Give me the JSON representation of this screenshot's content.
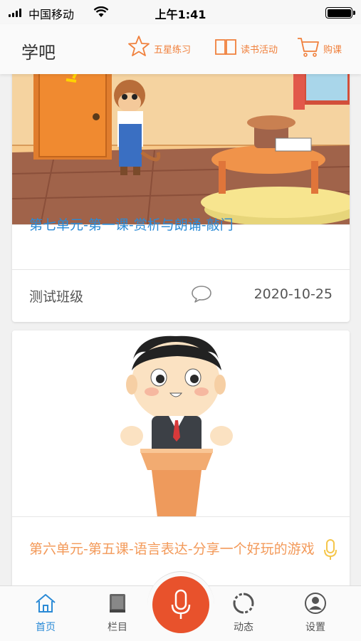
{
  "status_bar": {
    "carrier": "中国移动",
    "time": "上午1:41"
  },
  "header": {
    "title": "学吧",
    "actions": [
      {
        "label": "五星练习",
        "icon": "star-icon"
      },
      {
        "label": "读书活动",
        "icon": "book-icon"
      },
      {
        "label": "购课",
        "icon": "cart-icon"
      }
    ]
  },
  "cards": [
    {
      "image": "cartoon-monkey-at-door-illustration",
      "title": "第七单元-第一课-赏析与朗诵-敲门",
      "class_name": "测试班级",
      "comment_icon": "comment-icon",
      "date": "2020-10-25"
    },
    {
      "image": "cartoon-speaker-at-podium-illustration",
      "title": "第六单元-第五课-语言表达-分享一个好玩的游戏",
      "title_icon": "microphone-icon"
    }
  ],
  "tab_bar": {
    "items": [
      {
        "label": "首页",
        "icon": "home-icon",
        "active": true
      },
      {
        "label": "栏目",
        "icon": "book-stack-icon",
        "active": false
      },
      {
        "label": "动态",
        "icon": "refresh-circle-icon",
        "active": false
      },
      {
        "label": "设置",
        "icon": "user-settings-icon",
        "active": false
      }
    ],
    "record_icon": "microphone-icon"
  },
  "colors": {
    "accent_blue": "#2a8ad6",
    "accent_orange": "#f0803c",
    "record_red": "#e8522c",
    "title_orange": "#f39a5a"
  }
}
